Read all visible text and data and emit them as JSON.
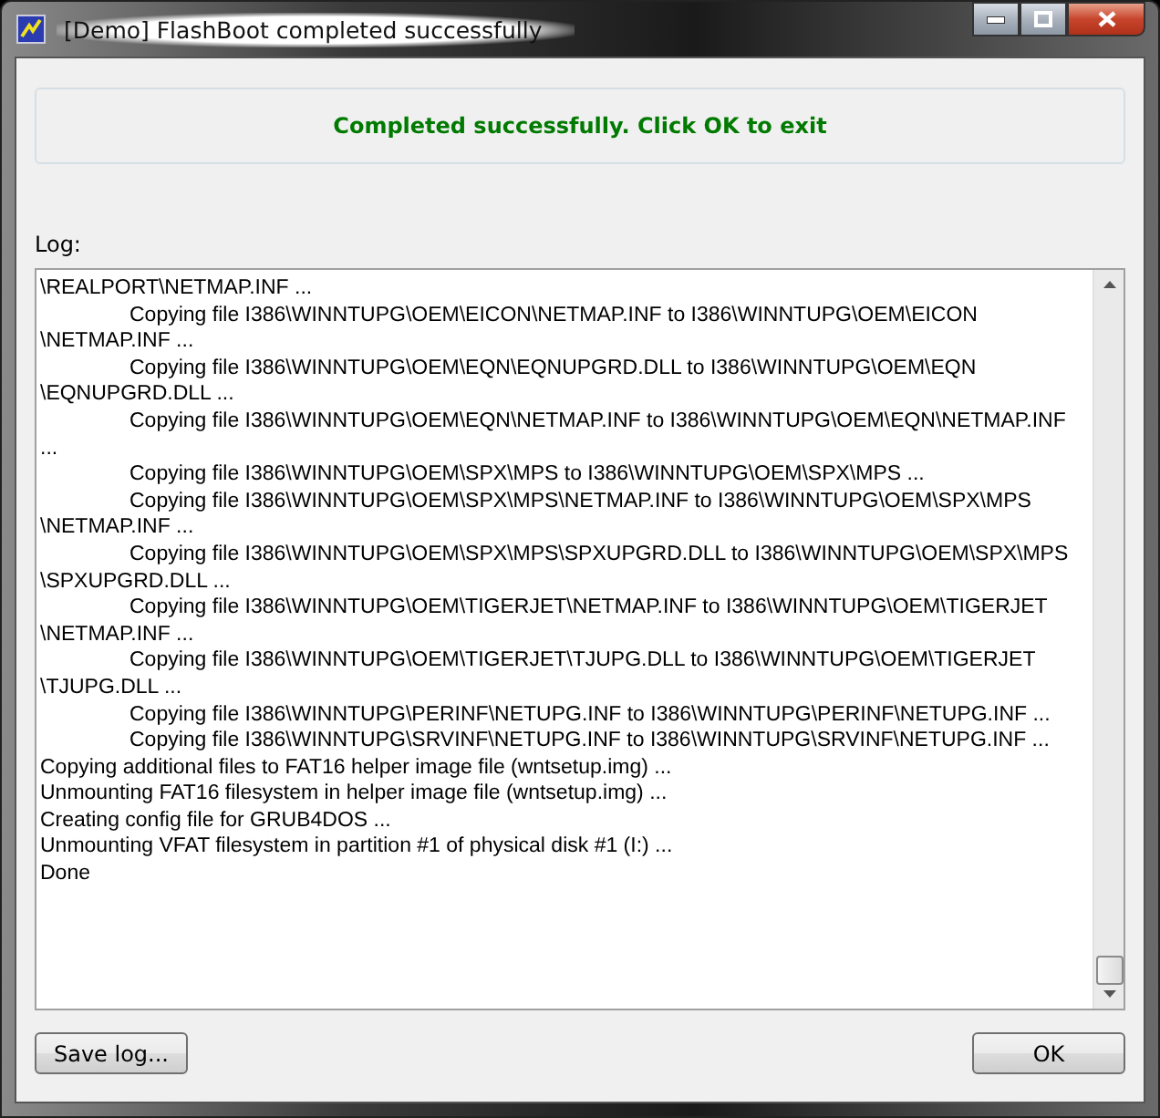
{
  "window": {
    "title": "[Demo] FlashBoot completed successfully"
  },
  "status": {
    "message": "Completed successfully. Click OK to exit"
  },
  "log": {
    "label": "Log:",
    "lines": [
      {
        "kind": "plain",
        "text": "\\REALPORT\\NETMAP.INF ..."
      },
      {
        "kind": "indented",
        "text": "Copying file I386\\WINNTUPG\\OEM\\EICON\\NETMAP.INF to I386\\WINNTUPG\\OEM\\EICON"
      },
      {
        "kind": "plain",
        "text": "\\NETMAP.INF ..."
      },
      {
        "kind": "indented",
        "text": "Copying file I386\\WINNTUPG\\OEM\\EQN\\EQNUPGRD.DLL to I386\\WINNTUPG\\OEM\\EQN"
      },
      {
        "kind": "plain",
        "text": "\\EQNUPGRD.DLL ..."
      },
      {
        "kind": "indented",
        "text": "Copying file I386\\WINNTUPG\\OEM\\EQN\\NETMAP.INF to I386\\WINNTUPG\\OEM\\EQN\\NETMAP.INF"
      },
      {
        "kind": "plain",
        "text": "..."
      },
      {
        "kind": "indented",
        "text": "Copying file I386\\WINNTUPG\\OEM\\SPX\\MPS to I386\\WINNTUPG\\OEM\\SPX\\MPS ..."
      },
      {
        "kind": "indented",
        "text": "Copying file I386\\WINNTUPG\\OEM\\SPX\\MPS\\NETMAP.INF to I386\\WINNTUPG\\OEM\\SPX\\MPS"
      },
      {
        "kind": "plain",
        "text": "\\NETMAP.INF ..."
      },
      {
        "kind": "indented",
        "text": "Copying file I386\\WINNTUPG\\OEM\\SPX\\MPS\\SPXUPGRD.DLL to I386\\WINNTUPG\\OEM\\SPX\\MPS"
      },
      {
        "kind": "plain",
        "text": "\\SPXUPGRD.DLL ..."
      },
      {
        "kind": "indented",
        "text": "Copying file I386\\WINNTUPG\\OEM\\TIGERJET\\NETMAP.INF to I386\\WINNTUPG\\OEM\\TIGERJET"
      },
      {
        "kind": "plain",
        "text": "\\NETMAP.INF ..."
      },
      {
        "kind": "indented",
        "text": "Copying file I386\\WINNTUPG\\OEM\\TIGERJET\\TJUPG.DLL to I386\\WINNTUPG\\OEM\\TIGERJET"
      },
      {
        "kind": "plain",
        "text": "\\TJUPG.DLL ..."
      },
      {
        "kind": "indented",
        "text": "Copying file I386\\WINNTUPG\\PERINF\\NETUPG.INF to I386\\WINNTUPG\\PERINF\\NETUPG.INF ..."
      },
      {
        "kind": "indented",
        "text": "Copying file I386\\WINNTUPG\\SRVINF\\NETUPG.INF to I386\\WINNTUPG\\SRVINF\\NETUPG.INF ..."
      },
      {
        "kind": "plain",
        "text": "Copying additional files to FAT16 helper image file (wntsetup.img) ..."
      },
      {
        "kind": "plain",
        "text": "Unmounting FAT16 filesystem in helper image file (wntsetup.img) ..."
      },
      {
        "kind": "plain",
        "text": "Creating config file for GRUB4DOS ..."
      },
      {
        "kind": "plain",
        "text": "Unmounting VFAT filesystem in partition #1 of physical disk #1 (I:) ..."
      },
      {
        "kind": "plain",
        "text": "Done"
      }
    ]
  },
  "buttons": {
    "save": "Save log...",
    "ok": "OK"
  }
}
